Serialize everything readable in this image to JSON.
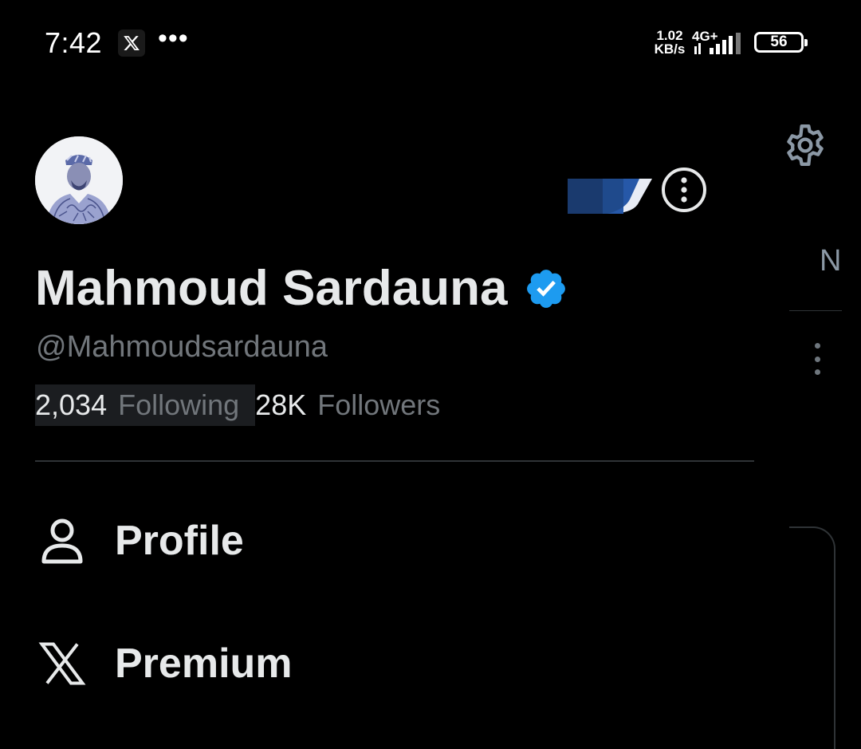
{
  "status_bar": {
    "time": "7:42",
    "notification_icon": "x-app-icon",
    "more": "•••",
    "speed_value": "1.02",
    "speed_unit": "KB/s",
    "network": "4G+",
    "battery": "56"
  },
  "profile": {
    "display_name": "Mahmoud Sardauna",
    "handle": "@Mahmoudsardauna",
    "verified": true,
    "following_count": "2,034",
    "following_label": "Following",
    "followers_count": "28K",
    "followers_label": "Followers",
    "accent_color": "#1d9bf0"
  },
  "menu": {
    "items": [
      {
        "label": "Profile",
        "icon": "person-icon"
      },
      {
        "label": "Premium",
        "icon": "x-logo-icon"
      }
    ]
  },
  "background": {
    "settings_icon": "gear-icon",
    "partial_tab_letter": "N"
  }
}
